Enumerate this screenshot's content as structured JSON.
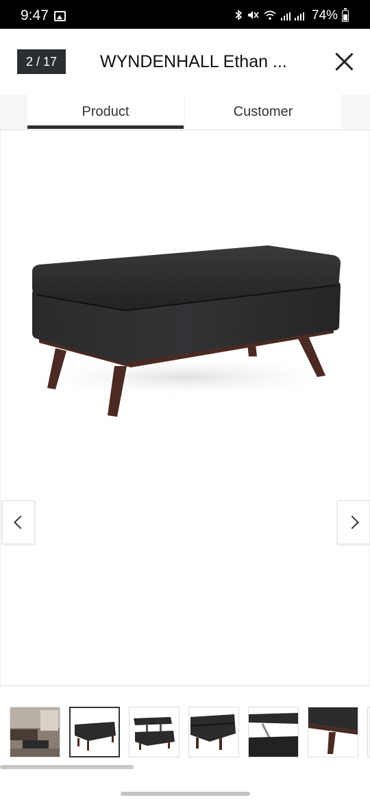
{
  "status_bar": {
    "time": "9:47",
    "battery_percent": "74%"
  },
  "header": {
    "counter": "2 / 17",
    "title": "WYNDENHALL Ethan ...",
    "close_icon": "close-icon"
  },
  "tabs": [
    {
      "label": "Product",
      "active": true
    },
    {
      "label": "Customer",
      "active": false
    }
  ],
  "gallery": {
    "prev_icon": "chevron-left-icon",
    "next_icon": "chevron-right-icon",
    "selected_index": 1,
    "thumbnails": [
      {
        "name": "living-room-scene"
      },
      {
        "name": "ottoman-front"
      },
      {
        "name": "ottoman-lift-top"
      },
      {
        "name": "ottoman-closeup"
      },
      {
        "name": "ottoman-hinge-detail"
      },
      {
        "name": "ottoman-leg-detail"
      }
    ]
  },
  "colors": {
    "accent": "#2b2f33",
    "ottoman_leather": "#2a2a2b",
    "leg_wood": "#4a2a22"
  }
}
